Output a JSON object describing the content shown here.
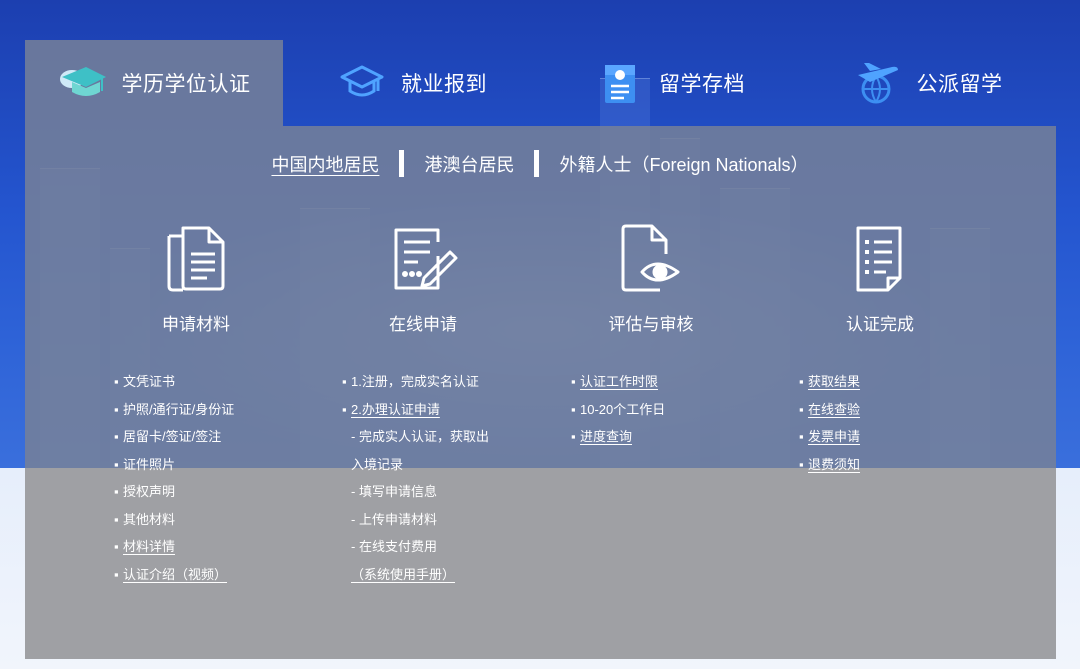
{
  "tabs": [
    {
      "label": "学历学位认证",
      "icon": "graduation-cap-icon",
      "active": true
    },
    {
      "label": "就业报到",
      "icon": "mortarboard-outline-icon",
      "active": false
    },
    {
      "label": "留学存档",
      "icon": "archive-document-icon",
      "active": false
    },
    {
      "label": "公派留学",
      "icon": "airplane-globe-icon",
      "active": false
    }
  ],
  "subnav": [
    {
      "label": "中国内地居民",
      "active": true
    },
    {
      "label": "港澳台居民",
      "active": false
    },
    {
      "label": "外籍人士（Foreign Nationals）",
      "active": false
    }
  ],
  "steps": [
    {
      "title": "申请材料",
      "icon": "documents-icon",
      "items": [
        {
          "text": "文凭证书",
          "link": false
        },
        {
          "text": "护照/通行证/身份证",
          "link": false
        },
        {
          "text": "居留卡/签证/签注",
          "link": false
        },
        {
          "text": "证件照片",
          "link": false
        },
        {
          "text": "授权声明",
          "link": false
        },
        {
          "text": "其他材料",
          "link": false
        },
        {
          "text": "材料详情",
          "link": true
        },
        {
          "text": "认证介绍（视频）",
          "link": true
        }
      ]
    },
    {
      "title": "在线申请",
      "icon": "form-edit-icon",
      "items": [
        {
          "text": "1.注册，完成实名认证",
          "link": false
        },
        {
          "text": "2.办理认证申请",
          "link": true
        },
        {
          "text": "- 完成实人认证，获取出",
          "link": false,
          "sub": true
        },
        {
          "text": "入境记录",
          "link": false,
          "sub": true
        },
        {
          "text": "- 填写申请信息",
          "link": false,
          "sub": true
        },
        {
          "text": "- 上传申请材料",
          "link": false,
          "sub": true
        },
        {
          "text": "- 在线支付费用",
          "link": false,
          "sub": true
        },
        {
          "text": "（系统使用手册）",
          "link": true,
          "sub": true
        }
      ]
    },
    {
      "title": "评估与审核",
      "icon": "document-eye-icon",
      "items": [
        {
          "text": "认证工作时限",
          "link": true
        },
        {
          "text": "10-20个工作日",
          "link": false
        },
        {
          "text": "进度查询",
          "link": true
        }
      ]
    },
    {
      "title": "认证完成",
      "icon": "checklist-icon",
      "items": [
        {
          "text": "获取结果",
          "link": true
        },
        {
          "text": "在线查验",
          "link": true
        },
        {
          "text": "发票申请",
          "link": true
        },
        {
          "text": "退费须知",
          "link": true
        }
      ]
    }
  ]
}
